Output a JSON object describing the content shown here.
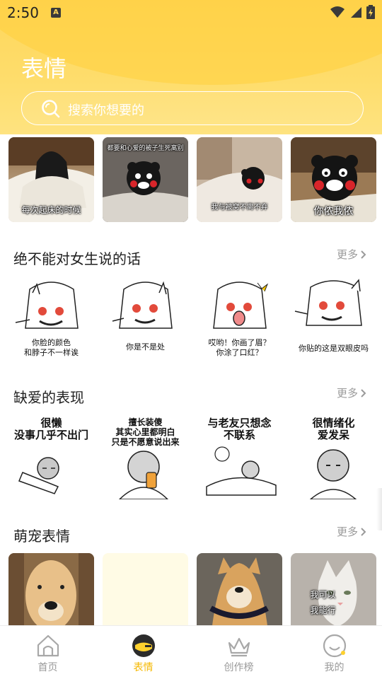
{
  "status_bar": {
    "time": "2:50",
    "notification_icon": "A"
  },
  "header": {
    "title": "表情",
    "search_placeholder": "搜索你想要的"
  },
  "featured": [
    {
      "caption": "每次起床的时候"
    },
    {
      "caption": "都要和心爱的被子生死离别"
    },
    {
      "caption": "我与被窝不离不弃"
    },
    {
      "caption": "你侬我侬"
    }
  ],
  "sections": [
    {
      "title": "绝不能对女生说的话",
      "more": "更多",
      "items": [
        {
          "caption": "你脸的颜色\n和脖子不一样诶"
        },
        {
          "caption": "你是不是处"
        },
        {
          "caption": "哎哟！你画了眉？\n你涂了口红？"
        },
        {
          "caption": "你贴的这是双眼皮吗"
        }
      ]
    },
    {
      "title": "缺爱的表现",
      "more": "更多",
      "items": [
        {
          "caption": "很懒\n没事几乎不出门"
        },
        {
          "caption": "擅长装傻\n其实心里都明白\n只是不愿意说出来"
        },
        {
          "caption": "与老友只想念\n不联系"
        },
        {
          "caption": "很情绪化\n爱发呆"
        }
      ]
    },
    {
      "title": "萌宠表情",
      "more": "更多",
      "items": [
        {
          "caption": ""
        },
        {
          "caption": ""
        },
        {
          "caption": ""
        },
        {
          "caption": "我可以\n我能行"
        }
      ]
    }
  ],
  "tabbar": [
    {
      "label": "首页",
      "icon": "home-icon",
      "active": false
    },
    {
      "label": "表情",
      "icon": "emoji-icon",
      "active": true
    },
    {
      "label": "创作榜",
      "icon": "crown-icon",
      "active": false
    },
    {
      "label": "我的",
      "icon": "profile-icon",
      "active": false
    }
  ],
  "colors": {
    "accent": "#f5b800",
    "header": "#fed65a",
    "muted": "#9a9a9a"
  }
}
